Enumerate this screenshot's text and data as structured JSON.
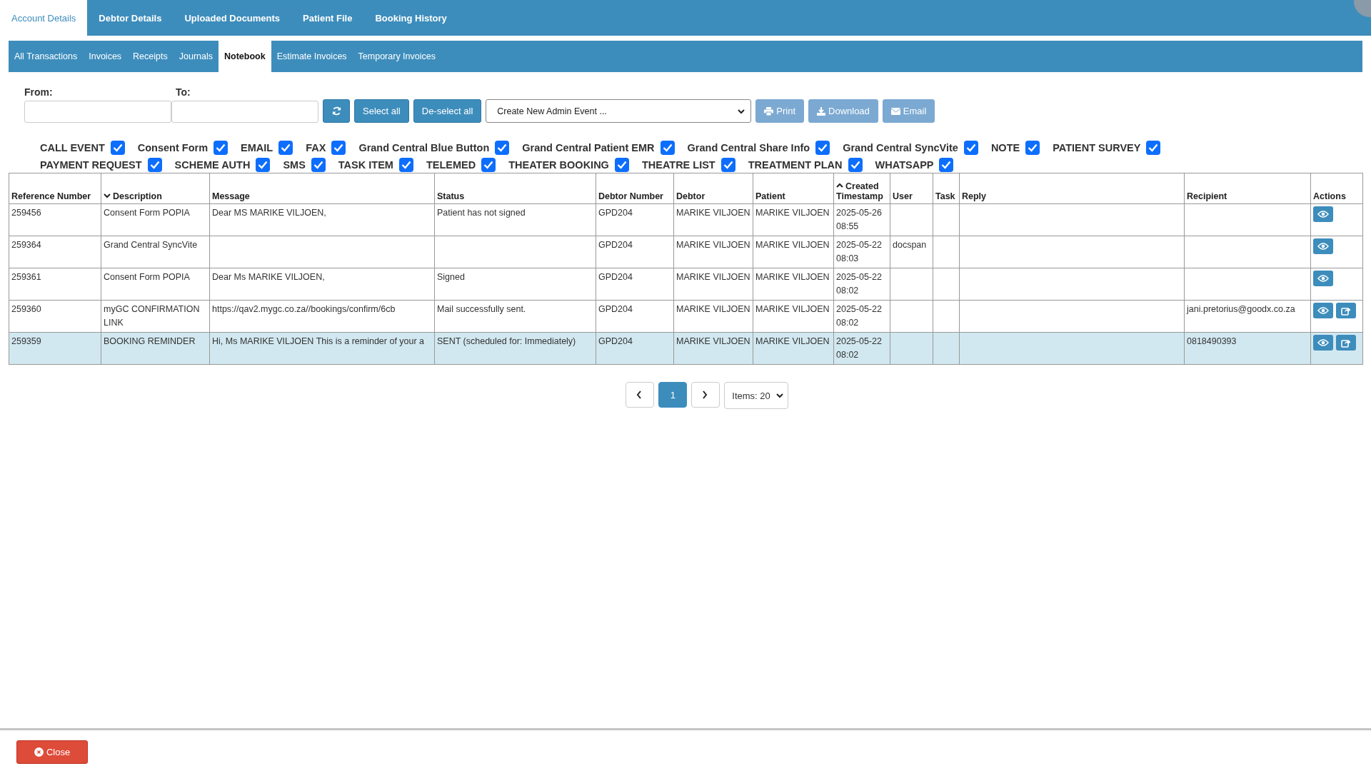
{
  "main_tabs": [
    {
      "label": "Account Details",
      "selected": true
    },
    {
      "label": "Debtor Details",
      "selected": false
    },
    {
      "label": "Uploaded Documents",
      "selected": false
    },
    {
      "label": "Patient File",
      "selected": false
    },
    {
      "label": "Booking History",
      "selected": false
    }
  ],
  "sub_tabs": [
    {
      "label": "All Transactions",
      "selected": false
    },
    {
      "label": "Invoices",
      "selected": false
    },
    {
      "label": "Receipts",
      "selected": false
    },
    {
      "label": "Journals",
      "selected": false
    },
    {
      "label": "Notebook",
      "selected": true
    },
    {
      "label": "Estimate Invoices",
      "selected": false
    },
    {
      "label": "Temporary Invoices",
      "selected": false
    }
  ],
  "filters": {
    "from_label": "From:",
    "to_label": "To:",
    "select_all": "Select all",
    "deselect_all": "De-select all",
    "admin_event": "Create New Admin Event ...",
    "actions": [
      {
        "kind": "print",
        "label": "Print",
        "disabled": true
      },
      {
        "kind": "download",
        "label": "Download",
        "disabled": true
      },
      {
        "kind": "email",
        "label": "Email",
        "disabled": true
      }
    ]
  },
  "event_types": [
    {
      "label": "CALL EVENT",
      "checked": true
    },
    {
      "label": "Consent Form",
      "checked": true
    },
    {
      "label": "EMAIL",
      "checked": true
    },
    {
      "label": "FAX",
      "checked": true
    },
    {
      "label": "Grand Central Blue Button",
      "checked": true
    },
    {
      "label": "Grand Central Patient EMR",
      "checked": true
    },
    {
      "label": "Grand Central Share Info",
      "checked": true
    },
    {
      "label": "Grand Central SyncVite",
      "checked": true
    },
    {
      "label": "NOTE",
      "checked": true
    },
    {
      "label": "PATIENT SURVEY",
      "checked": true
    },
    {
      "label": "PAYMENT REQUEST",
      "checked": true
    },
    {
      "label": "SCHEME AUTH",
      "checked": true
    },
    {
      "label": "SMS",
      "checked": true
    },
    {
      "label": "TASK ITEM",
      "checked": true
    },
    {
      "label": "TELEMED",
      "checked": true
    },
    {
      "label": "THEATER BOOKING",
      "checked": true
    },
    {
      "label": "THEATRE LIST",
      "checked": true
    },
    {
      "label": "TREATMENT PLAN",
      "checked": true
    },
    {
      "label": "WHATSAPP",
      "checked": true
    }
  ],
  "table": {
    "columns": [
      {
        "label": "Reference Number",
        "sorted_ascending": false,
        "sorted_descending": false
      },
      {
        "label": "Description",
        "sorted_ascending": false,
        "sorted_descending": true
      },
      {
        "label": "Message",
        "sorted_ascending": false,
        "sorted_descending": false
      },
      {
        "label": "Status",
        "sorted_ascending": false,
        "sorted_descending": false
      },
      {
        "label": "Debtor Number",
        "sorted_ascending": false,
        "sorted_descending": false
      },
      {
        "label": "Debtor",
        "sorted_ascending": false,
        "sorted_descending": false
      },
      {
        "label": "Patient",
        "sorted_ascending": false,
        "sorted_descending": false
      },
      {
        "label": "Created Timestamp",
        "sorted_ascending": true,
        "sorted_descending": false
      },
      {
        "label": "User",
        "sorted_ascending": false,
        "sorted_descending": false
      },
      {
        "label": "Task",
        "sorted_ascending": false,
        "sorted_descending": false
      },
      {
        "label": "Reply",
        "sorted_ascending": false,
        "sorted_descending": false
      },
      {
        "label": "Recipient",
        "sorted_ascending": false,
        "sorted_descending": false
      },
      {
        "label": "Actions",
        "sorted_ascending": false,
        "sorted_descending": false
      }
    ],
    "rows": [
      {
        "selected": false,
        "cells": [
          "259456",
          "Consent Form POPIA",
          "Dear MS MARIKE VILJOEN,",
          "Patient has not signed",
          "GPD204",
          "MARIKE VILJOEN",
          "MARIKE VILJOEN",
          "2025-05-26 08:55",
          "",
          "",
          "",
          ""
        ],
        "actions": [
          {
            "kind": "view"
          }
        ]
      },
      {
        "selected": false,
        "cells": [
          "259364",
          "Grand Central SyncVite",
          "",
          "",
          "GPD204",
          "MARIKE VILJOEN",
          "MARIKE VILJOEN",
          "2025-05-22 08:03",
          "docspan",
          "",
          "",
          ""
        ],
        "actions": [
          {
            "kind": "view"
          }
        ]
      },
      {
        "selected": false,
        "cells": [
          "259361",
          "Consent Form POPIA",
          "Dear Ms MARIKE VILJOEN,",
          "Signed",
          "GPD204",
          "MARIKE VILJOEN",
          "MARIKE VILJOEN",
          "2025-05-22 08:02",
          "",
          "",
          "",
          ""
        ],
        "actions": [
          {
            "kind": "view"
          }
        ]
      },
      {
        "selected": false,
        "cells": [
          "259360",
          "myGC CONFIRMATION LINK",
          "https://qav2.mygc.co.za//bookings/confirm/6cb",
          "Mail successfully sent.",
          "GPD204",
          "MARIKE VILJOEN",
          "MARIKE VILJOEN",
          "2025-05-22 08:02",
          "",
          "",
          "",
          "jani.pretorius@goodx.co.za"
        ],
        "actions": [
          {
            "kind": "view"
          },
          {
            "kind": "share"
          }
        ]
      },
      {
        "selected": true,
        "cells": [
          "259359",
          "BOOKING REMINDER",
          "Hi, Ms MARIKE VILJOEN This is a reminder of your a",
          "SENT (scheduled for: Immediately)",
          "GPD204",
          "MARIKE VILJOEN",
          "MARIKE VILJOEN",
          "2025-05-22 08:02",
          "",
          "",
          "",
          "0818490393"
        ],
        "actions": [
          {
            "kind": "view"
          },
          {
            "kind": "share"
          }
        ]
      }
    ]
  },
  "pagination": {
    "pages": [
      {
        "label": "1",
        "selected": true
      }
    ],
    "page_size": "Items: 20"
  },
  "footer": {
    "close": "Close"
  }
}
